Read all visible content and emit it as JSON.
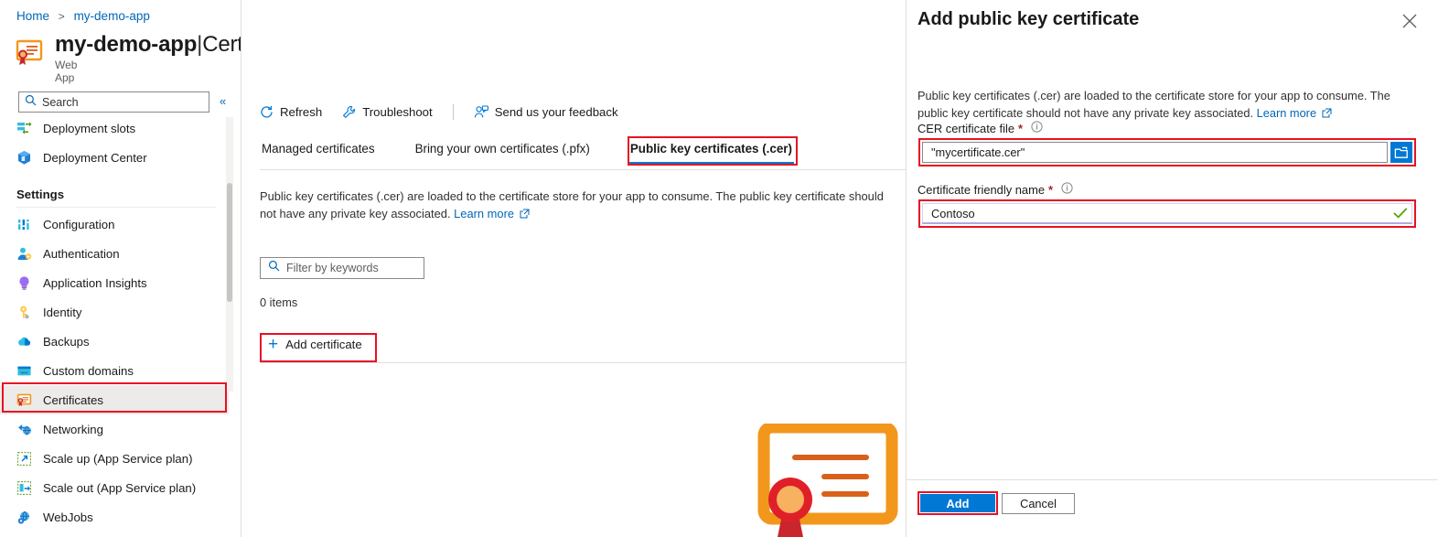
{
  "breadcrumb": {
    "home": "Home",
    "separator": ">",
    "current": "my-demo-app"
  },
  "header": {
    "resource_name": "my-demo-app",
    "divider": "|",
    "section": "Certificates",
    "resource_type": "Web App",
    "icon": "certificate-icon",
    "favorite_icon": "star-icon",
    "more_icon": "ellipsis-icon"
  },
  "sidebar": {
    "search_placeholder": "Search",
    "search_icon": "search-icon",
    "collapse_icon": "double-chevron-left-icon",
    "items": [
      {
        "label": "Deployment slots",
        "icon": "deployment-slots-icon",
        "selected": false
      },
      {
        "label": "Deployment Center",
        "icon": "deployment-center-icon",
        "selected": false
      }
    ],
    "settings_header": "Settings",
    "settings_items": [
      {
        "label": "Configuration",
        "icon": "configuration-icon",
        "selected": false
      },
      {
        "label": "Authentication",
        "icon": "authentication-icon",
        "selected": false
      },
      {
        "label": "Application Insights",
        "icon": "application-insights-icon",
        "selected": false
      },
      {
        "label": "Identity",
        "icon": "identity-key-icon",
        "selected": false
      },
      {
        "label": "Backups",
        "icon": "backups-cloud-icon",
        "selected": false
      },
      {
        "label": "Custom domains",
        "icon": "custom-domains-icon",
        "selected": false
      },
      {
        "label": "Certificates",
        "icon": "certificate-icon",
        "selected": true
      },
      {
        "label": "Networking",
        "icon": "networking-icon",
        "selected": false
      },
      {
        "label": "Scale up (App Service plan)",
        "icon": "scale-up-icon",
        "selected": false
      },
      {
        "label": "Scale out (App Service plan)",
        "icon": "scale-out-icon",
        "selected": false
      },
      {
        "label": "WebJobs",
        "icon": "webjobs-icon",
        "selected": false
      }
    ]
  },
  "toolbar": {
    "refresh": "Refresh",
    "refresh_icon": "refresh-icon",
    "troubleshoot": "Troubleshoot",
    "troubleshoot_icon": "wrench-icon",
    "feedback": "Send us your feedback",
    "feedback_icon": "feedback-person-icon"
  },
  "pivots": [
    {
      "label": "Managed certificates",
      "active": false
    },
    {
      "label": "Bring your own certificates (.pfx)",
      "active": false
    },
    {
      "label": "Public key certificates (.cer)",
      "active": true
    }
  ],
  "content": {
    "description": "Public key certificates (.cer) are loaded to the certificate store for your app to consume. The public key certificate should not have any private key associated.",
    "learn_more": "Learn more",
    "external_link_icon": "external-link-icon",
    "filter_placeholder": "Filter by keywords",
    "filter_icon": "search-icon",
    "item_count": "0 items",
    "add_certificate": "Add certificate",
    "add_icon": "plus-icon",
    "illustration": "certificate-illustration"
  },
  "panel": {
    "title": "Add public key certificate",
    "close_icon": "close-icon",
    "description": "Public key certificates (.cer) are loaded to the certificate store for your app to consume. The public key certificate should not have any private key associated.",
    "learn_more": "Learn more",
    "external_link_icon": "external-link-icon",
    "fields": [
      {
        "label": "CER certificate file",
        "required_marker": "*",
        "info_icon": "info-icon",
        "value": "\"mycertificate.cer\"",
        "browse_icon": "folder-browse-icon"
      },
      {
        "label": "Certificate friendly name",
        "required_marker": "*",
        "info_icon": "info-icon",
        "value": "Contoso",
        "valid_icon": "checkmark-icon"
      }
    ],
    "primary_button": "Add",
    "secondary_button": "Cancel"
  },
  "colors": {
    "accent_blue": "#0078d4",
    "link_blue": "#0067b8",
    "highlight_red": "#e81123",
    "required_red": "#a4262c",
    "selected_bg": "#edebe9",
    "valid_green": "#57a300",
    "cert_orange": "#f2971b",
    "cert_seal_red": "#c9252d"
  }
}
